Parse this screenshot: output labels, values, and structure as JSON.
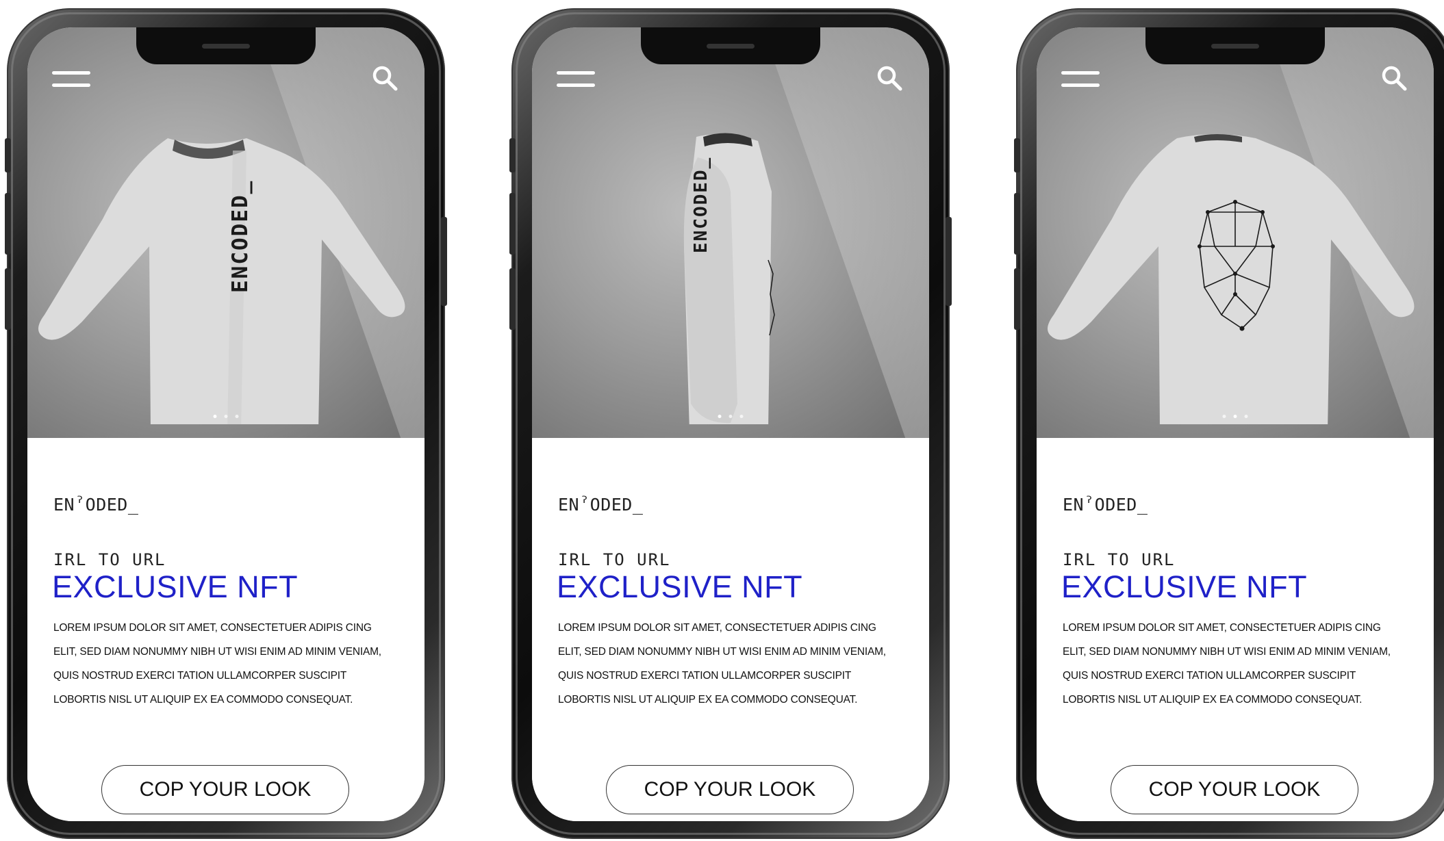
{
  "screens": [
    {
      "brand": "ENˀODED_",
      "kicker": "IRL TO URL",
      "title": "EXCLUSIVE NFT",
      "body": "LOREM IPSUM DOLOR SIT AMET, CONSECTETUER ADIPIS CING ELIT, SED DIAM NONUMMY NIBH UT WISI ENIM AD MINIM VENIAM, QUIS NOSTRUD EXERCI TATION ULLAMCORPER SUSCIPIT LOBORTIS NISL UT ALIQUIP EX EA COMMODO CONSEQUAT.",
      "cta": "COP YOUR LOOK",
      "shirt_print": "ENCODED_",
      "carousel": {
        "count": 3,
        "active": 1
      }
    },
    {
      "brand": "ENˀODED_",
      "kicker": "IRL TO URL",
      "title": "EXCLUSIVE NFT",
      "body": "LOREM IPSUM DOLOR SIT AMET, CONSECTETUER ADIPIS CING ELIT, SED DIAM NONUMMY NIBH UT WISI ENIM AD MINIM VENIAM, QUIS NOSTRUD EXERCI TATION ULLAMCORPER SUSCIPIT LOBORTIS NISL UT ALIQUIP EX EA COMMODO CONSEQUAT.",
      "cta": "COP YOUR LOOK",
      "shirt_print": "ENCODED_",
      "carousel": {
        "count": 3,
        "active": 1
      }
    },
    {
      "brand": "ENˀODED_",
      "kicker": "IRL TO URL",
      "title": "EXCLUSIVE NFT",
      "body": "LOREM IPSUM DOLOR SIT AMET, CONSECTETUER ADIPIS CING ELIT, SED DIAM NONUMMY NIBH UT WISI ENIM AD MINIM VENIAM, QUIS NOSTRUD EXERCI TATION ULLAMCORPER SUSCIPIT LOBORTIS NISL UT ALIQUIP EX EA COMMODO CONSEQUAT.",
      "cta": "COP YOUR LOOK",
      "carousel": {
        "count": 3,
        "active": 2
      }
    }
  ],
  "icons": {
    "menu": "hamburger-menu-icon",
    "search": "search-icon"
  },
  "colors": {
    "accent": "#1f21c8",
    "phone_frame": "#111111",
    "hero_bg": "#9b9b9b"
  }
}
